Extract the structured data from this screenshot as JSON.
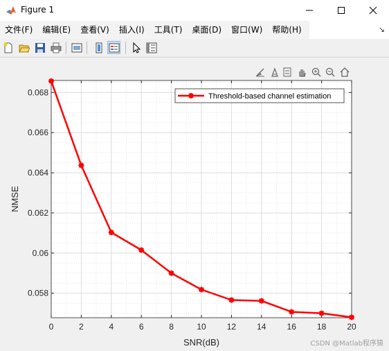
{
  "window": {
    "title": "Figure 1",
    "minimize_icon": "minimize-icon",
    "maximize_icon": "maximize-icon",
    "close_icon": "close-icon"
  },
  "menu": {
    "items": [
      "文件(F)",
      "编辑(E)",
      "查看(V)",
      "插入(I)",
      "工具(T)",
      "桌面(D)",
      "窗口(W)",
      "帮助(H)"
    ]
  },
  "toolbar": {
    "icons": [
      "new-figure-icon",
      "open-file-icon",
      "save-icon",
      "print-icon",
      "link-plot-icon",
      "colorbar-icon",
      "legend-icon",
      "pointer-icon",
      "property-inspector-icon"
    ]
  },
  "axes_toolbar": {
    "icons": [
      "brush-icon",
      "data-tips-icon",
      "rotate-icon",
      "pan-icon",
      "zoom-in-icon",
      "zoom-out-icon",
      "home-icon"
    ]
  },
  "watermark": "CSDN @Matlab程序猿",
  "chart_data": {
    "type": "line",
    "xlabel": "SNR(dB)",
    "ylabel": "NMSE",
    "xlim": [
      0,
      20
    ],
    "ylim": [
      0.05678,
      0.0686
    ],
    "xticks": [
      0,
      2,
      4,
      6,
      8,
      10,
      12,
      14,
      16,
      18,
      20
    ],
    "yticks": [
      0.058,
      0.06,
      0.062,
      0.064,
      0.066,
      0.068
    ],
    "ytick_labels": [
      "0.058",
      "0.06",
      "0.062",
      "0.064",
      "0.066",
      "0.068"
    ],
    "grid": true,
    "minor_grid": true,
    "legend_placement": "top-right",
    "series": [
      {
        "name": "Threshold-based channel estimation",
        "color": "#ff0000",
        "marker": "asterisk",
        "x": [
          0,
          2,
          4,
          6,
          8,
          10,
          12,
          14,
          16,
          18,
          20
        ],
        "y": [
          0.06857,
          0.06437,
          0.06103,
          0.06015,
          0.059,
          0.05818,
          0.05766,
          0.05762,
          0.05707,
          0.057,
          0.0568
        ]
      }
    ]
  }
}
